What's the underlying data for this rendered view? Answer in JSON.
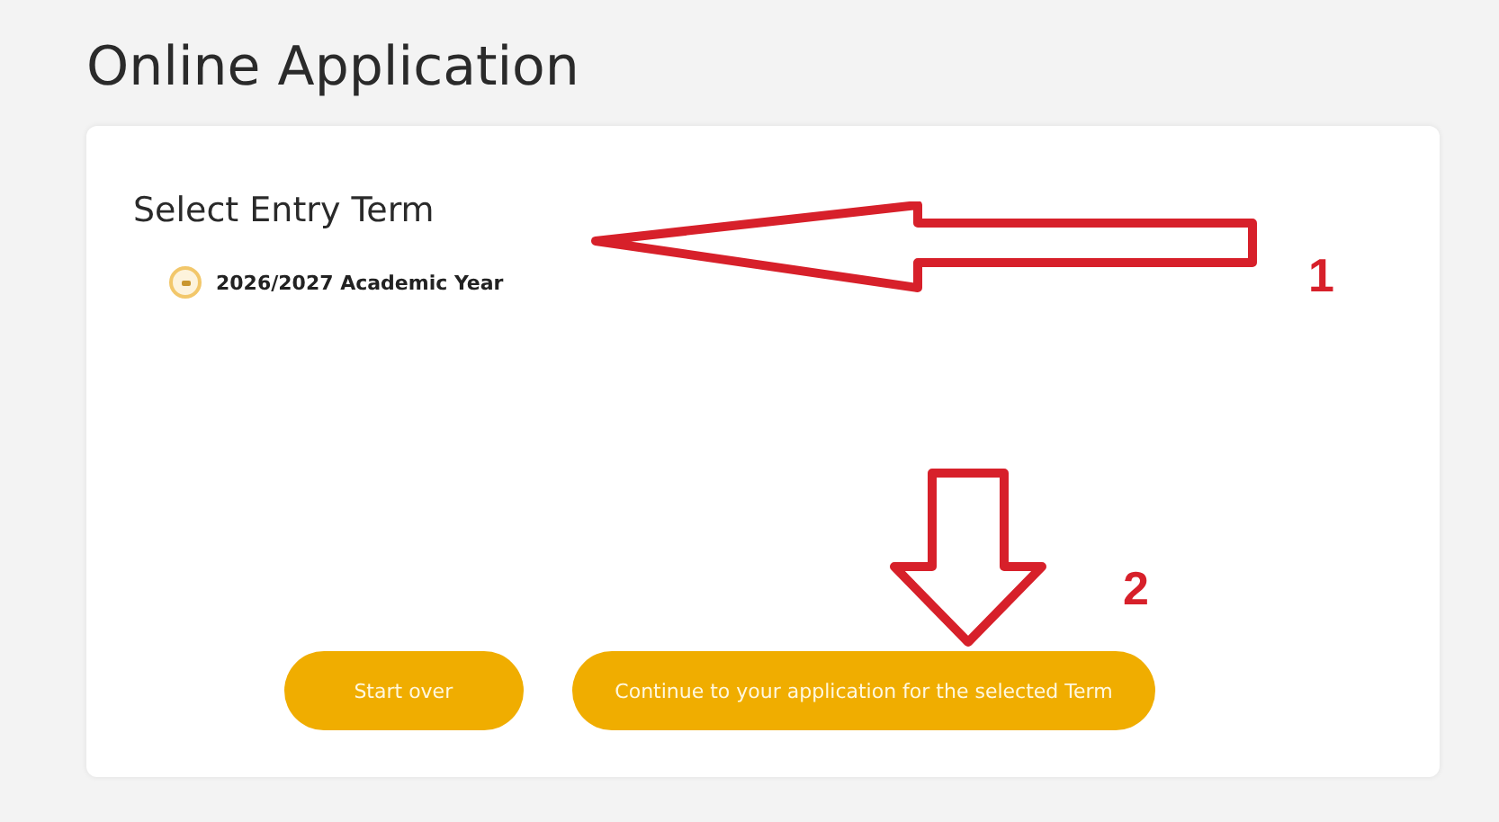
{
  "page": {
    "title": "Online Application"
  },
  "card": {
    "heading": "Select Entry Term",
    "options": [
      {
        "label": "2026/2027 Academic Year",
        "selected": true
      }
    ],
    "buttons": [
      {
        "label": "Start over"
      },
      {
        "label": "Continue to your application for the selected Term"
      }
    ]
  },
  "annotations": [
    {
      "kind": "left-arrow",
      "label": "1"
    },
    {
      "kind": "down-arrow",
      "label": "2"
    }
  ]
}
